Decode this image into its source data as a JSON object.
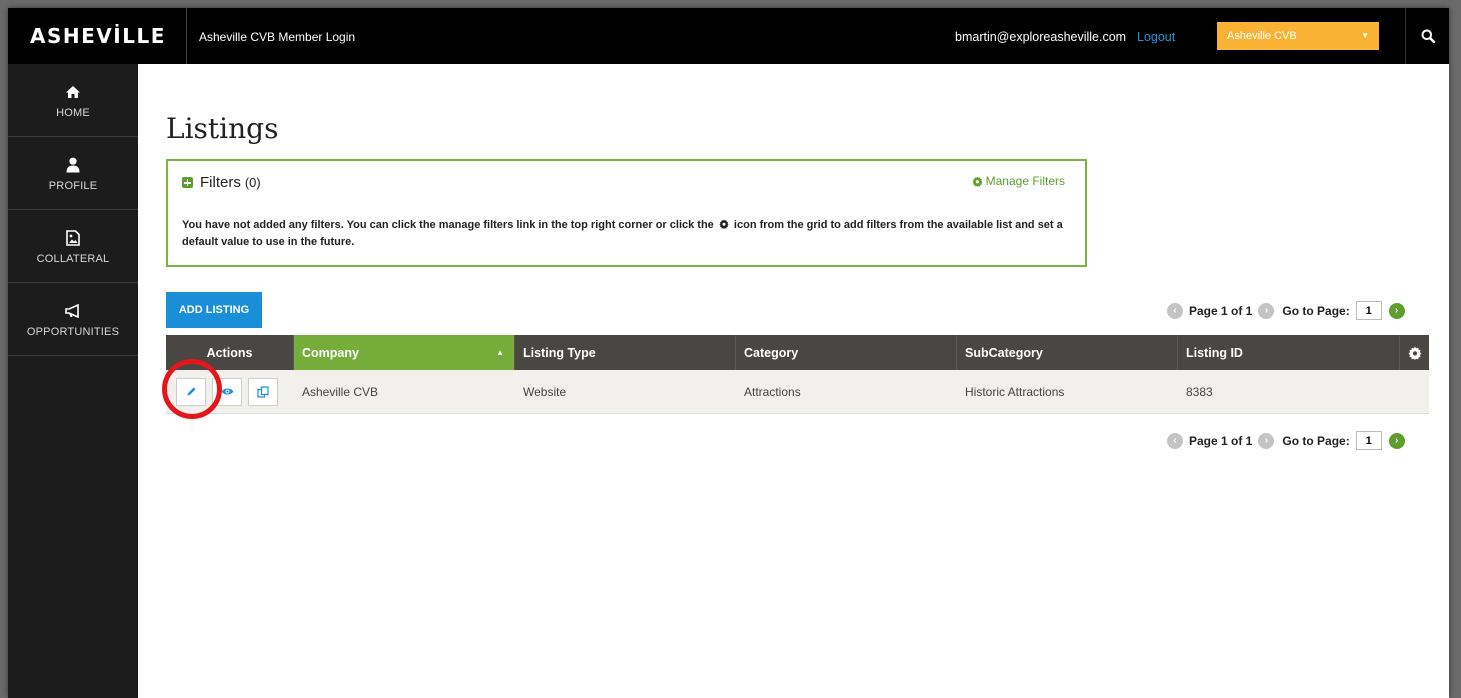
{
  "topbar": {
    "logo": "ASHEVİLLE",
    "app_title": "Asheville CVB Member Login",
    "user_email": "bmartin@exploreasheville.com",
    "logout_label": "Logout",
    "org_selected": "Asheville CVB",
    "search_icon": "search-icon"
  },
  "sidebar": {
    "items": [
      {
        "label": "HOME",
        "icon": "home-icon"
      },
      {
        "label": "PROFILE",
        "icon": "user-icon"
      },
      {
        "label": "COLLATERAL",
        "icon": "image-file-icon"
      },
      {
        "label": "OPPORTUNITIES",
        "icon": "megaphone-icon"
      }
    ]
  },
  "main": {
    "title": "Listings",
    "filters": {
      "title": "Filters",
      "count": "(0)",
      "manage_label": "Manage Filters",
      "message_part1": "You have not added any filters. You can click the manage filters link in the top right corner or click the",
      "message_part2": "icon from the grid to add filters from the available list and set a default value to use in the future."
    },
    "add_listing_label": "ADD LISTING",
    "pager": {
      "page_text": "Page 1 of 1",
      "goto_label": "Go to Page:",
      "page_value": "1"
    },
    "grid": {
      "columns": [
        "Actions",
        "Company",
        "Listing Type",
        "Category",
        "SubCategory",
        "Listing ID"
      ],
      "rows": [
        {
          "company": "Asheville CVB",
          "listing_type": "Website",
          "category": "Attractions",
          "subcategory": "Historic Attractions",
          "listing_id": "8383"
        }
      ]
    }
  },
  "colors": {
    "accent_green": "#76ad3a",
    "brand_blue": "#1a8fd8",
    "org_orange": "#f9b233",
    "highlight_red": "#e3161b"
  }
}
